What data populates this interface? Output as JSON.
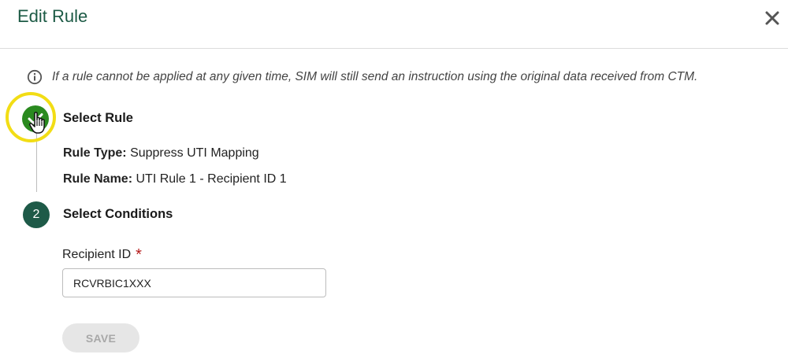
{
  "dialog": {
    "title": "Edit Rule",
    "close_icon": "close-icon"
  },
  "info": {
    "icon": "info-icon",
    "text": "If a rule cannot be applied at any given time, SIM will still send an instruction using the original data received from CTM."
  },
  "steps": [
    {
      "status": "completed",
      "icon": "checkmark-icon",
      "title": "Select Rule",
      "details": [
        {
          "label": "Rule Type:",
          "value": "Suppress UTI Mapping"
        },
        {
          "label": "Rule Name:",
          "value": "UTI Rule 1 - Recipient ID 1"
        }
      ]
    },
    {
      "status": "active",
      "number": "2",
      "title": "Select Conditions"
    }
  ],
  "form": {
    "recipient_label": "Recipient ID",
    "required_marker": "*",
    "recipient_value": "RCVRBIC1XXX"
  },
  "actions": {
    "save_label": "SAVE"
  },
  "colors": {
    "title": "#1c5a45",
    "completed_step": "#2a8a1f",
    "active_step": "#1e5a48",
    "highlight_ring": "#f2dd15",
    "required": "#b41a1a"
  }
}
